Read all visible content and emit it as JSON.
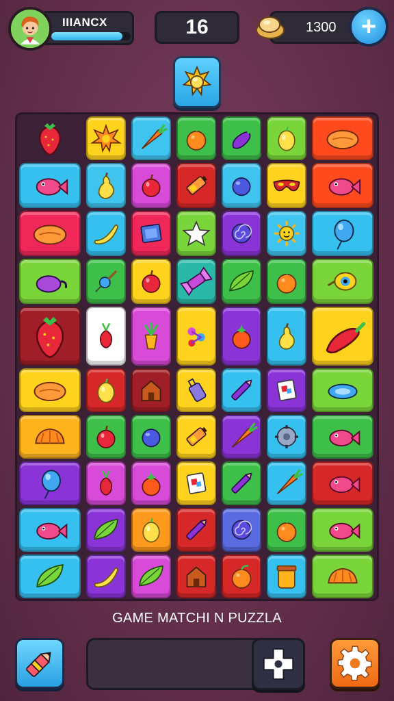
{
  "hud": {
    "player_name": "IIIANCX",
    "xp_progress": 0.9,
    "score": "16",
    "coins": "1300",
    "plus_label": "+"
  },
  "target": {
    "icon": "sun-gem-icon"
  },
  "board": {
    "rows": [
      [
        {
          "color": "#3c2036",
          "icon": "strawberry-icon",
          "empty": true
        },
        {
          "color": "#ffd21e",
          "icon": "starburst-icon"
        },
        {
          "color": "#3fc4f0",
          "icon": "carrot-icon"
        },
        {
          "color": "#3dbf4a",
          "icon": "orange-icon"
        },
        {
          "color": "#3dbf4a",
          "icon": "eggplant-icon"
        },
        {
          "color": "#7ad53a",
          "icon": "lemon-icon"
        },
        {
          "color": "#ff4a1e",
          "icon": "bread-icon"
        }
      ],
      [
        {
          "color": "#36c0f0",
          "icon": "fish-icon"
        },
        {
          "color": "#3fc4f0",
          "icon": "pear-icon"
        },
        {
          "color": "#d84ad8",
          "icon": "apple-icon"
        },
        {
          "color": "#d62828",
          "icon": "battery-icon"
        },
        {
          "color": "#3fc4f0",
          "icon": "blueberry-icon"
        },
        {
          "color": "#ffd21e",
          "icon": "mask-icon"
        },
        {
          "color": "#ff4a1e",
          "icon": "fish-icon"
        }
      ],
      [
        {
          "color": "#f0285a",
          "icon": "bread-icon"
        },
        {
          "color": "#36c0f0",
          "icon": "banana-icon"
        },
        {
          "color": "#f0285a",
          "icon": "box-icon"
        },
        {
          "color": "#7ad53a",
          "icon": "star-icon"
        },
        {
          "color": "#8a34d8",
          "icon": "spiral-icon"
        },
        {
          "color": "#3fc4f0",
          "icon": "sun-icon"
        },
        {
          "color": "#36c0f0",
          "icon": "balloon-icon"
        }
      ],
      [
        {
          "color": "#7ad53a",
          "icon": "teapot-icon"
        },
        {
          "color": "#3dbf4a",
          "icon": "pin-icon"
        },
        {
          "color": "#ffd21e",
          "icon": "apple-icon"
        },
        {
          "color": "#2ab8a8",
          "icon": "candy-icon"
        },
        {
          "color": "#3dbf4a",
          "icon": "leaf-icon"
        },
        {
          "color": "#3dbf4a",
          "icon": "orange-icon"
        },
        {
          "color": "#7ad53a",
          "icon": "eye-icon"
        }
      ],
      [
        {
          "color": "#a01e28",
          "icon": "strawberry-icon"
        },
        {
          "color": "#ffffff",
          "icon": "radish-icon"
        },
        {
          "color": "#d84ad8",
          "icon": "plant-icon"
        },
        {
          "color": "#ffd21e",
          "icon": "flower-icon"
        },
        {
          "color": "#8a34d8",
          "icon": "tomato-icon"
        },
        {
          "color": "#36c0f0",
          "icon": "pear-icon"
        },
        {
          "color": "#ffd21e",
          "icon": "pepper-icon"
        }
      ],
      [
        {
          "color": "#ffd21e",
          "icon": "bread-icon"
        },
        {
          "color": "#d62828",
          "icon": "lemon-icon"
        },
        {
          "color": "#a01e28",
          "icon": "house-icon"
        },
        {
          "color": "#ffd21e",
          "icon": "bottle-icon"
        },
        {
          "color": "#36c0f0",
          "icon": "pen-icon"
        },
        {
          "color": "#8a34d8",
          "icon": "card-icon"
        },
        {
          "color": "#7ad53a",
          "icon": "disc-icon"
        }
      ],
      [
        {
          "color": "#ffb41e",
          "icon": "shell-icon"
        },
        {
          "color": "#3dbf4a",
          "icon": "apple-icon"
        },
        {
          "color": "#3dbf4a",
          "icon": "blueberry-icon"
        },
        {
          "color": "#ffd21e",
          "icon": "battery-icon"
        },
        {
          "color": "#8a34d8",
          "icon": "carrot-icon"
        },
        {
          "color": "#36c0f0",
          "icon": "gear-icon"
        },
        {
          "color": "#3dbf4a",
          "icon": "fish-icon"
        }
      ],
      [
        {
          "color": "#8a34d8",
          "icon": "balloon-icon"
        },
        {
          "color": "#d84ad8",
          "icon": "radish-icon"
        },
        {
          "color": "#d84ad8",
          "icon": "tomato-icon"
        },
        {
          "color": "#ffd21e",
          "icon": "card-icon"
        },
        {
          "color": "#3dbf4a",
          "icon": "pen-icon"
        },
        {
          "color": "#36c0f0",
          "icon": "carrot-icon"
        },
        {
          "color": "#d62828",
          "icon": "fish-icon"
        }
      ],
      [
        {
          "color": "#36c0f0",
          "icon": "fish-icon"
        },
        {
          "color": "#8a34d8",
          "icon": "leaf-icon"
        },
        {
          "color": "#ff9a1e",
          "icon": "lemon-icon"
        },
        {
          "color": "#d62828",
          "icon": "pen-icon"
        },
        {
          "color": "#5a6ae0",
          "icon": "spiral-icon"
        },
        {
          "color": "#3dbf4a",
          "icon": "orange-icon"
        },
        {
          "color": "#7ad53a",
          "icon": "fish-icon"
        }
      ],
      [
        {
          "color": "#36c0f0",
          "icon": "leaf-icon"
        },
        {
          "color": "#8a34d8",
          "icon": "banana-icon"
        },
        {
          "color": "#d84ad8",
          "icon": "leaf-icon"
        },
        {
          "color": "#d62828",
          "icon": "house-icon"
        },
        {
          "color": "#d62828",
          "icon": "orange-icon"
        },
        {
          "color": "#36c0f0",
          "icon": "jar-icon"
        },
        {
          "color": "#7ad53a",
          "icon": "shell-icon"
        }
      ]
    ]
  },
  "footer": {
    "title": "GAME MATCHI N PUZZLA",
    "left_button_icon": "pencil-icon",
    "dpad_icon": "dpad-icon",
    "settings_icon": "gear-icon"
  }
}
